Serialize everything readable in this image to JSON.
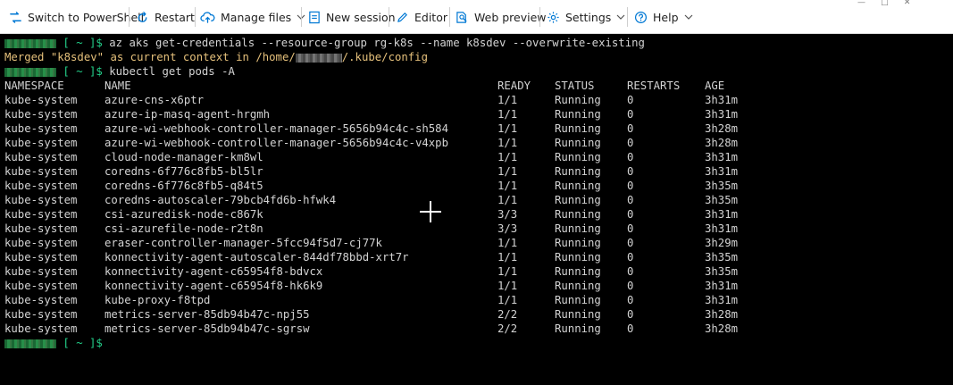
{
  "toolbar": {
    "switch_label": "Switch to PowerShell",
    "restart_label": "Restart",
    "manage_files_label": "Manage files",
    "new_session_label": "New session",
    "editor_label": "Editor",
    "web_preview_label": "Web preview",
    "settings_label": "Settings",
    "help_label": "Help"
  },
  "terminal": {
    "prompt": "[ ~ ]$",
    "cmd1": "az aks get-credentials --resource-group rg-k8s --name k8sdev --overwrite-existing",
    "merged_a": "Merged \"k8sdev\" as current context in /home/",
    "merged_b": "/.kube/config",
    "cmd2": "kubectl get pods -A",
    "headers": [
      "NAMESPACE",
      "NAME",
      "READY",
      "STATUS",
      "RESTARTS",
      "AGE"
    ],
    "rows": [
      [
        "kube-system",
        "azure-cns-x6ptr",
        "1/1",
        "Running",
        "0",
        "3h31m"
      ],
      [
        "kube-system",
        "azure-ip-masq-agent-hrgmh",
        "1/1",
        "Running",
        "0",
        "3h31m"
      ],
      [
        "kube-system",
        "azure-wi-webhook-controller-manager-5656b94c4c-sh584",
        "1/1",
        "Running",
        "0",
        "3h28m"
      ],
      [
        "kube-system",
        "azure-wi-webhook-controller-manager-5656b94c4c-v4xpb",
        "1/1",
        "Running",
        "0",
        "3h28m"
      ],
      [
        "kube-system",
        "cloud-node-manager-km8wl",
        "1/1",
        "Running",
        "0",
        "3h31m"
      ],
      [
        "kube-system",
        "coredns-6f776c8fb5-bl5lr",
        "1/1",
        "Running",
        "0",
        "3h31m"
      ],
      [
        "kube-system",
        "coredns-6f776c8fb5-q84t5",
        "1/1",
        "Running",
        "0",
        "3h35m"
      ],
      [
        "kube-system",
        "coredns-autoscaler-79bcb4fd6b-hfwk4",
        "1/1",
        "Running",
        "0",
        "3h35m"
      ],
      [
        "kube-system",
        "csi-azuredisk-node-c867k",
        "3/3",
        "Running",
        "0",
        "3h31m"
      ],
      [
        "kube-system",
        "csi-azurefile-node-r2t8n",
        "3/3",
        "Running",
        "0",
        "3h31m"
      ],
      [
        "kube-system",
        "eraser-controller-manager-5fcc94f5d7-cj77k",
        "1/1",
        "Running",
        "0",
        "3h29m"
      ],
      [
        "kube-system",
        "konnectivity-agent-autoscaler-844df78bbd-xrt7r",
        "1/1",
        "Running",
        "0",
        "3h35m"
      ],
      [
        "kube-system",
        "konnectivity-agent-c65954f8-bdvcx",
        "1/1",
        "Running",
        "0",
        "3h35m"
      ],
      [
        "kube-system",
        "konnectivity-agent-c65954f8-hk6k9",
        "1/1",
        "Running",
        "0",
        "3h31m"
      ],
      [
        "kube-system",
        "kube-proxy-f8tpd",
        "1/1",
        "Running",
        "0",
        "3h31m"
      ],
      [
        "kube-system",
        "metrics-server-85db94b47c-npj55",
        "2/2",
        "Running",
        "0",
        "3h28m"
      ],
      [
        "kube-system",
        "metrics-server-85db94b47c-sgrsw",
        "2/2",
        "Running",
        "0",
        "3h28m"
      ]
    ]
  },
  "colors": {
    "prompt_green": "#23d18b",
    "warning_yellow": "#e5c07b",
    "toolbar_icon_blue": "#0078d4"
  }
}
